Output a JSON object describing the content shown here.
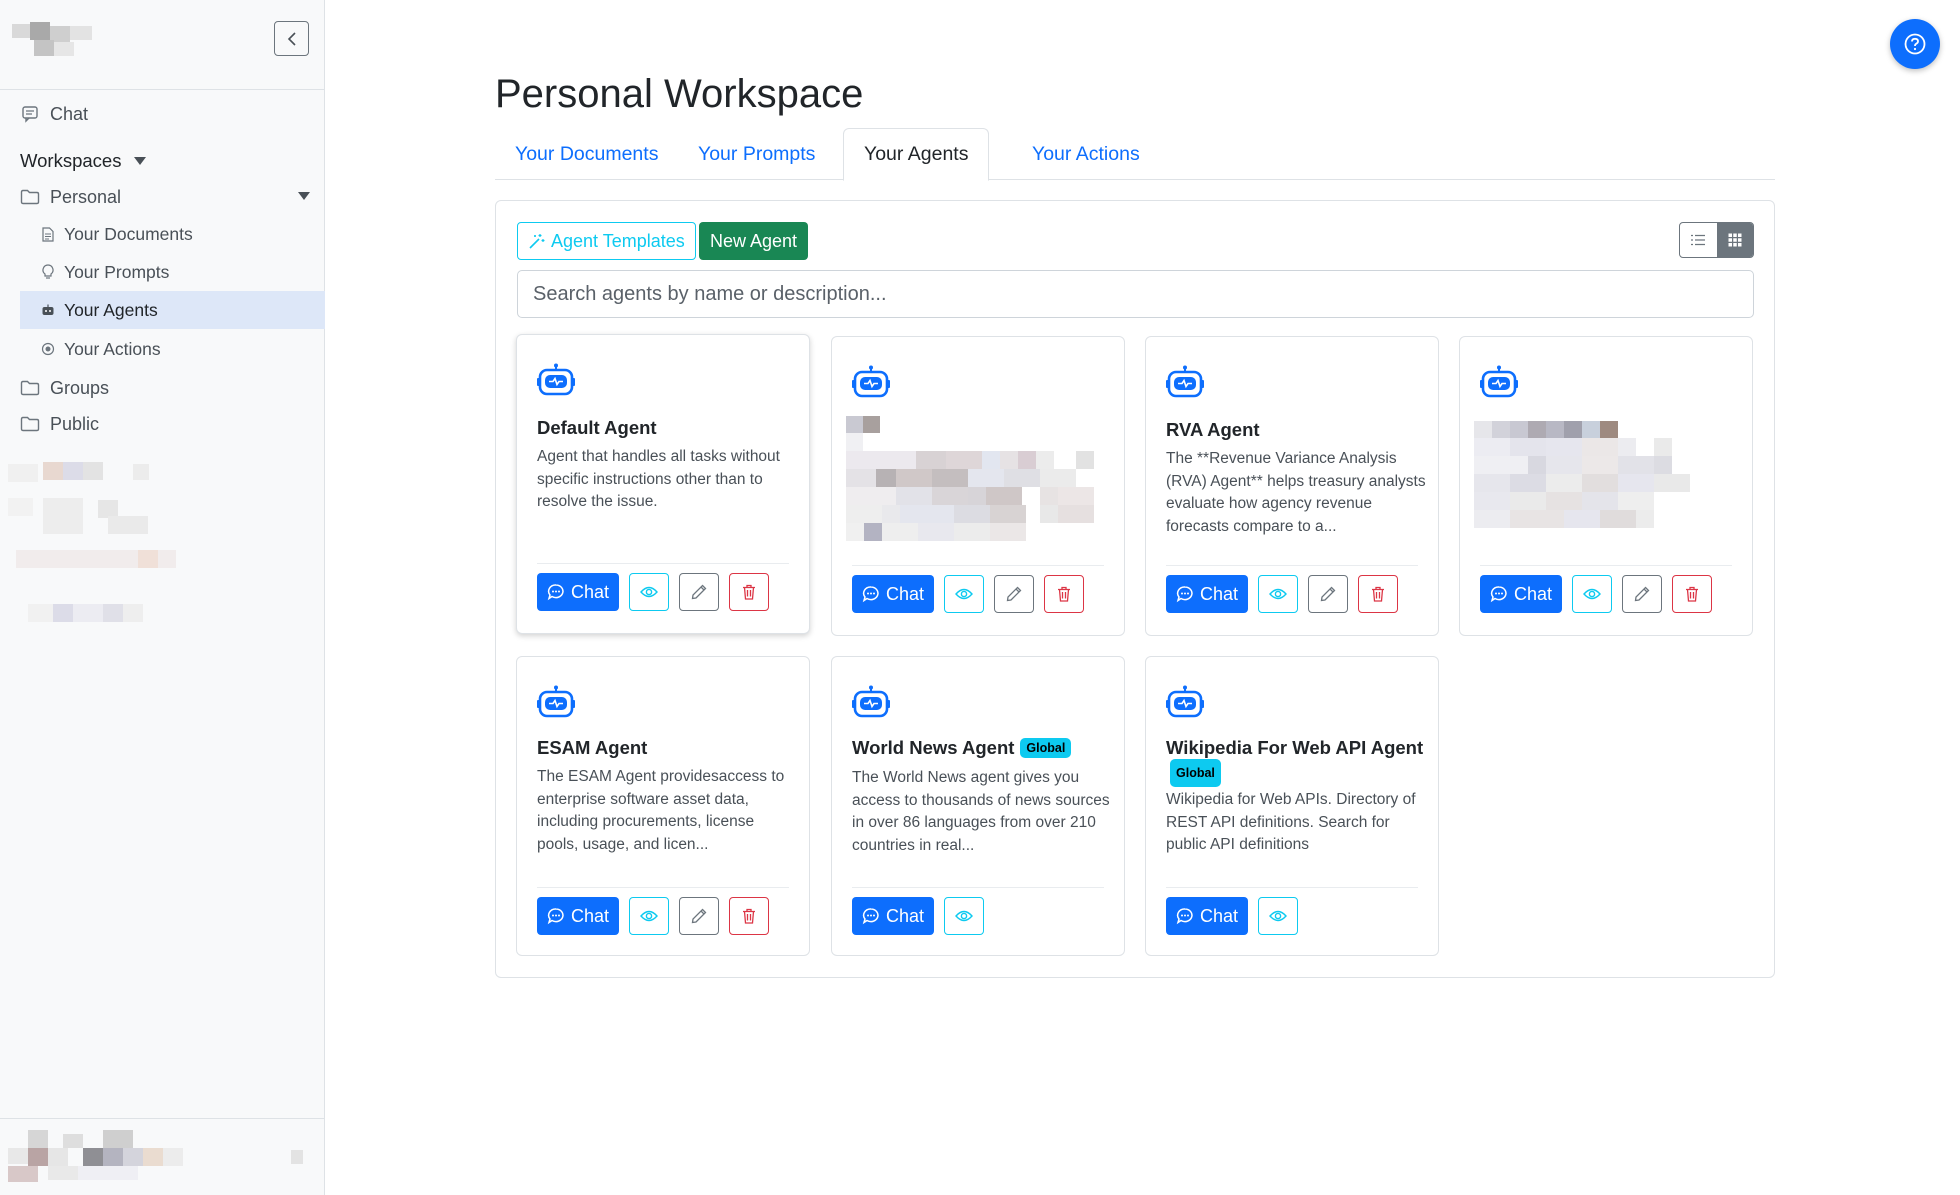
{
  "sidebar": {
    "chat_label": "Chat",
    "workspaces_label": "Workspaces",
    "personal_label": "Personal",
    "items": [
      {
        "label": "Your Documents",
        "icon": "document-icon"
      },
      {
        "label": "Your Prompts",
        "icon": "lightbulb-icon"
      },
      {
        "label": "Your Agents",
        "icon": "robot-icon",
        "active": true
      },
      {
        "label": "Your Actions",
        "icon": "actions-icon"
      }
    ],
    "groups_label": "Groups",
    "public_label": "Public"
  },
  "main": {
    "title": "Personal Workspace",
    "tabs": [
      {
        "label": "Your Documents"
      },
      {
        "label": "Your Prompts"
      },
      {
        "label": "Your Agents",
        "active": true
      },
      {
        "label": "Your Actions"
      }
    ],
    "toolbar": {
      "templates_label": "Agent Templates",
      "new_agent_label": "New Agent",
      "search_placeholder": "Search agents by name or description..."
    },
    "chat_label": "Chat",
    "agents": [
      {
        "name": "Default Agent",
        "description": "Agent that handles all tasks without specific instructions other than to resolve the issue.",
        "badge": ""
      },
      {
        "name": "",
        "description": "",
        "badge": "",
        "redacted": true
      },
      {
        "name": "RVA Agent",
        "description": "The **Revenue Variance Analysis (RVA) Agent** helps treasury analysts evaluate how agency revenue forecasts compare to a...",
        "badge": ""
      },
      {
        "name": "",
        "description": "",
        "badge": "",
        "redacted": true
      },
      {
        "name": "ESAM Agent",
        "description": "The ESAM Agent providesaccess to enterprise software asset data, including procurements, license pools, usage, and licen...",
        "badge": ""
      },
      {
        "name": "World News Agent",
        "description": "The World News agent gives you access to thousands of news sources in over 86 languages from over 210 countries in real...",
        "badge": "Global"
      },
      {
        "name": "Wikipedia For Web API Agent",
        "description": "Wikipedia for Web APIs. Directory of REST API definitions. Search for public API definitions",
        "badge": "Global"
      }
    ]
  },
  "colors": {
    "primary": "#0d6efd",
    "success": "#198754",
    "info": "#0dcaf0",
    "danger": "#dc3545",
    "secondary": "#6c757d"
  }
}
